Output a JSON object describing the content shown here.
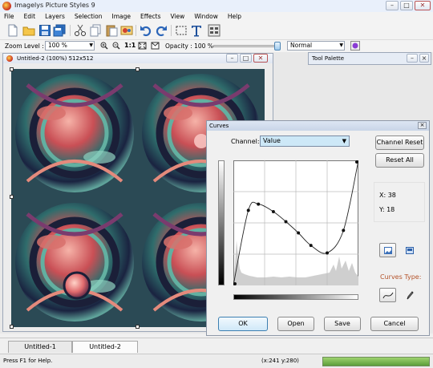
{
  "window": {
    "title": "Imagelys Picture Styles 9"
  },
  "menu": [
    "File",
    "Edit",
    "Layers",
    "Selection",
    "Image",
    "Effects",
    "View",
    "Window",
    "Help"
  ],
  "toolbar": {
    "icons": [
      "new-file-icon",
      "open-folder-icon",
      "save-icon",
      "save-all-icon",
      "cut-icon",
      "copy-icon",
      "paste-icon",
      "photo-icon",
      "undo-icon",
      "redo-icon",
      "select-rect-icon",
      "text-icon",
      "layers-grid-icon"
    ],
    "zoom_label": "Zoom Level :",
    "zoom_value": "100 %",
    "one_to_one": "1:1",
    "opacity_label": "Opacity : 100 %",
    "opacity_fraction": 1.0,
    "blend_mode": "Normal"
  },
  "document": {
    "title": "Untitled-2 (100%) 512x512"
  },
  "tool_palette": {
    "title": "Tool Palette"
  },
  "curves": {
    "title": "Curves",
    "channel_label": "Channel:",
    "channel_value": "Value",
    "channel_reset": "Channel Reset",
    "reset_all": "Reset All",
    "x_readout": "X: 38",
    "y_readout": "Y: 18",
    "curves_type_label": "Curves Type:",
    "ok": "OK",
    "open": "Open",
    "save": "Save",
    "cancel": "Cancel",
    "control_points": [
      [
        0,
        0
      ],
      [
        0.12,
        0.6
      ],
      [
        0.2,
        0.65
      ],
      [
        0.32,
        0.59
      ],
      [
        0.42,
        0.51
      ],
      [
        0.52,
        0.42
      ],
      [
        0.62,
        0.32
      ],
      [
        0.75,
        0.26
      ],
      [
        0.88,
        0.44
      ],
      [
        1.0,
        1.0
      ]
    ]
  },
  "tabs": [
    "Untitled-1",
    "Untitled-2"
  ],
  "active_tab": 1,
  "status": {
    "help": "Press F1 for Help.",
    "coords": "(x:241 y:280)"
  }
}
